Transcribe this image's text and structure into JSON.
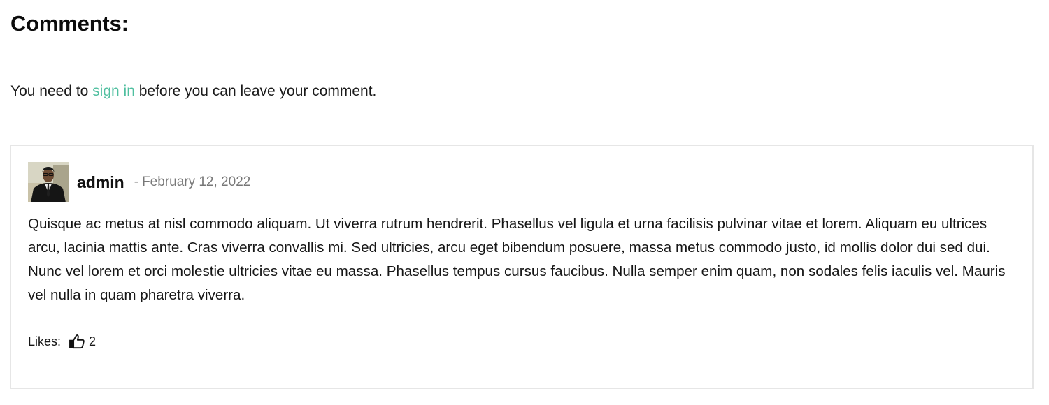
{
  "comments_section": {
    "title": "Comments:",
    "signin_prefix": "You need to ",
    "signin_link": "sign in",
    "signin_suffix": " before you can leave your comment.",
    "link_color": "#4fbf9f"
  },
  "comment": {
    "author": "admin",
    "date_separator": "-",
    "date": "February 12, 2022",
    "avatar_icon": "user-avatar-photo",
    "body": "Quisque ac metus at nisl commodo aliquam. Ut viverra rutrum hendrerit. Phasellus vel ligula et urna facilisis pulvinar vitae et lorem. Aliquam eu ultrices arcu, lacinia mattis ante. Cras viverra convallis mi. Sed ultricies, arcu eget bibendum posuere, massa metus commodo justo, id mollis dolor dui sed dui. Nunc vel lorem et orci molestie ultricies vitae eu massa. Phasellus tempus cursus faucibus. Nulla semper enim quam, non sodales felis iaculis vel. Mauris vel nulla in quam pharetra viverra.",
    "likes_label": "Likes:",
    "like_icon": "thumbs-up-icon",
    "likes_count": "2"
  }
}
